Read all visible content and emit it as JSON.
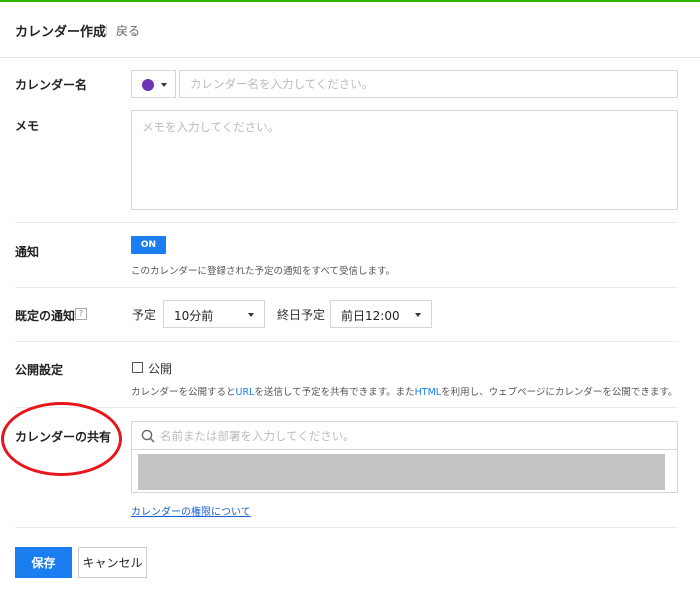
{
  "header": {
    "title": "カレンダー作成",
    "back": "戻る"
  },
  "calendar_name": {
    "label": "カレンダー名",
    "color": "#6f35b5",
    "placeholder": "カレンダー名を入力してください。"
  },
  "memo": {
    "label": "メモ",
    "placeholder": "メモを入力してください。"
  },
  "notification": {
    "label": "通知",
    "toggle": "ON",
    "description": "このカレンダーに登録された予定の通知をすべて受信します。"
  },
  "default_notification": {
    "label": "既定の通知",
    "help": "?",
    "schedule_label": "予定",
    "schedule_value": "10分前",
    "allday_label": "終日予定",
    "allday_value": "前日12:00"
  },
  "publish": {
    "label": "公開設定",
    "checkbox_label": "公開",
    "desc_1": "カレンダーを公開すると",
    "desc_url": "URL",
    "desc_2": "を送信して予定を共有できます。また",
    "desc_html": "HTML",
    "desc_3": "を利用し、ウェブページにカレンダーを公開できます。"
  },
  "share": {
    "label": "カレンダーの共有",
    "placeholder": "名前または部署を入力してください。",
    "permission_link": "カレンダーの権限について"
  },
  "actions": {
    "save": "保存",
    "cancel": "キャンセル"
  },
  "colors": {
    "accent": "#1a7df0",
    "top_bar": "#2db400",
    "annotation_circle": "#e8151b"
  }
}
